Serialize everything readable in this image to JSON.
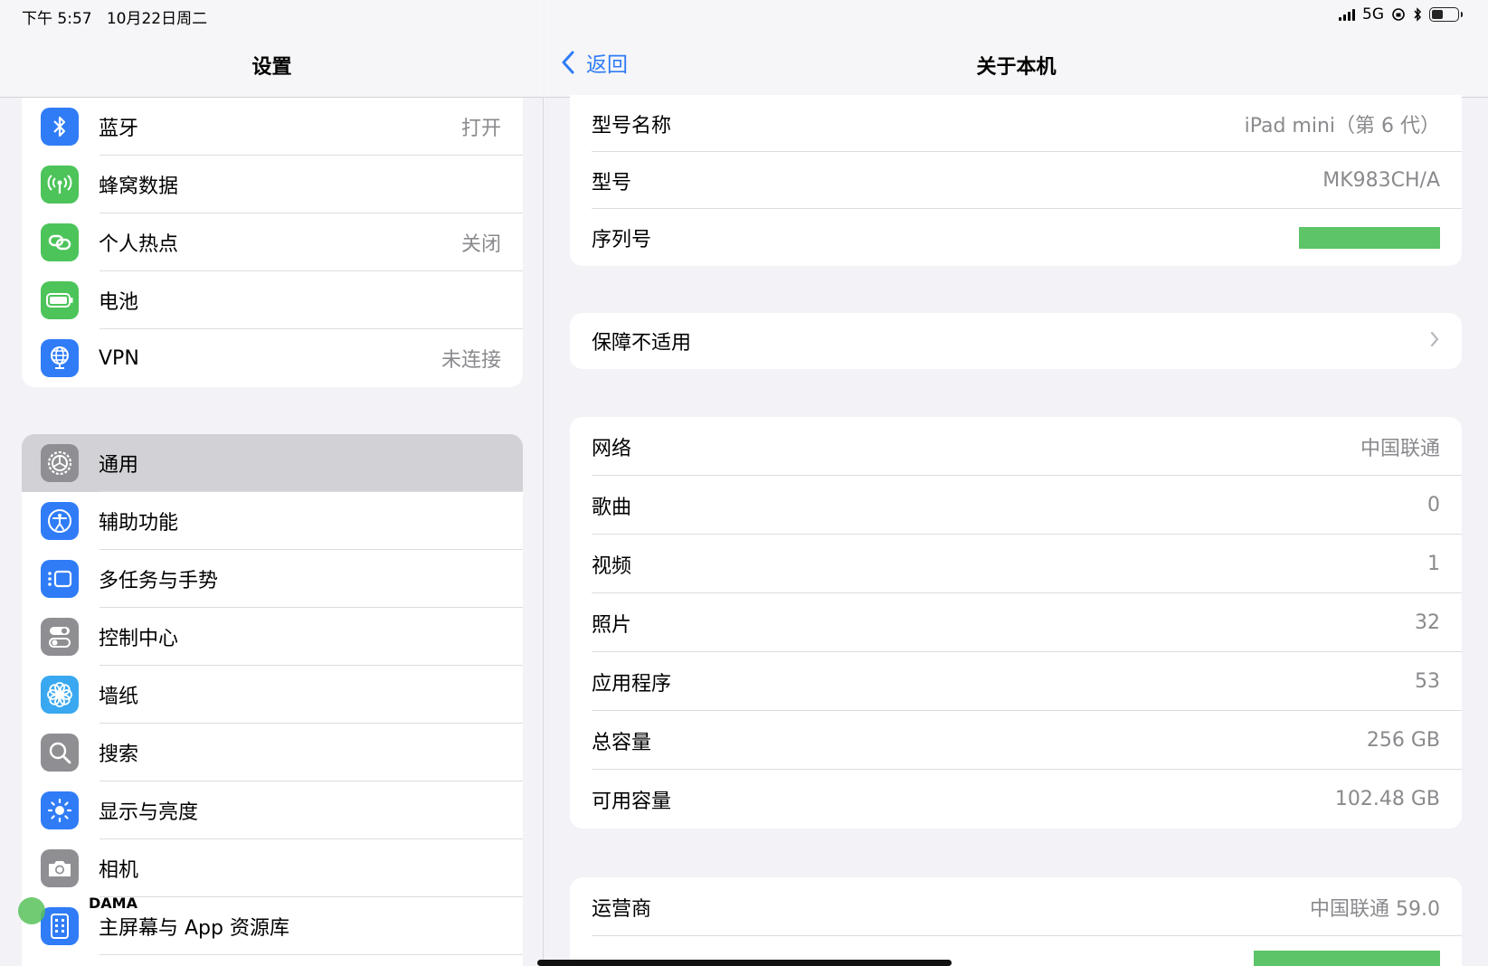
{
  "status_bar": {
    "time": "下午 5:57",
    "date": "10月22日周二",
    "network": "5G"
  },
  "sidebar": {
    "title": "设置",
    "group1": [
      {
        "label": "蓝牙",
        "value": "打开",
        "icon": "bluetooth-icon",
        "color": "#2f7cf6"
      },
      {
        "label": "蜂窝数据",
        "value": "",
        "icon": "antenna-icon",
        "color": "#4cc45a"
      },
      {
        "label": "个人热点",
        "value": "关闭",
        "icon": "hotspot-link-icon",
        "color": "#4cc45a"
      },
      {
        "label": "电池",
        "value": "",
        "icon": "battery-icon",
        "color": "#4cc45a"
      },
      {
        "label": "VPN",
        "value": "未连接",
        "icon": "globe-icon",
        "color": "#2f7cf6"
      }
    ],
    "group2": [
      {
        "label": "通用",
        "value": "",
        "icon": "gear-icon",
        "color": "#8e8e93",
        "selected": true
      },
      {
        "label": "辅助功能",
        "value": "",
        "icon": "accessibility-icon",
        "color": "#2f7cf6"
      },
      {
        "label": "多任务与手势",
        "value": "",
        "icon": "multitask-icon",
        "color": "#2f7cf6"
      },
      {
        "label": "控制中心",
        "value": "",
        "icon": "toggles-icon",
        "color": "#8e8e93"
      },
      {
        "label": "墙纸",
        "value": "",
        "icon": "flower-icon",
        "color": "#39a8f0"
      },
      {
        "label": "搜索",
        "value": "",
        "icon": "search-icon",
        "color": "#8e8e93"
      },
      {
        "label": "显示与亮度",
        "value": "",
        "icon": "sun-icon",
        "color": "#2f7cf6"
      },
      {
        "label": "相机",
        "value": "",
        "icon": "camera-icon",
        "color": "#8e8e93"
      },
      {
        "label": "主屏幕与 App 资源库",
        "value": "",
        "icon": "home-screen-icon",
        "color": "#2f7cf6"
      }
    ]
  },
  "detail": {
    "back_label": "返回",
    "title": "关于本机",
    "card1": [
      {
        "label": "型号名称",
        "value": "iPad mini（第 6 代）"
      },
      {
        "label": "型号",
        "value": "MK983CH/A"
      },
      {
        "label": "序列号",
        "value": ""
      }
    ],
    "card2": [
      {
        "label": "保障不适用"
      }
    ],
    "card3": [
      {
        "label": "网络",
        "value": "中国联通"
      },
      {
        "label": "歌曲",
        "value": "0"
      },
      {
        "label": "视频",
        "value": "1"
      },
      {
        "label": "照片",
        "value": "32"
      },
      {
        "label": "应用程序",
        "value": "53"
      },
      {
        "label": "总容量",
        "value": "256 GB"
      },
      {
        "label": "可用容量",
        "value": "102.48 GB"
      }
    ],
    "card4": [
      {
        "label": "运营商",
        "value": "中国联通 59.0"
      }
    ]
  },
  "watermark": {
    "text": "DAMA"
  }
}
